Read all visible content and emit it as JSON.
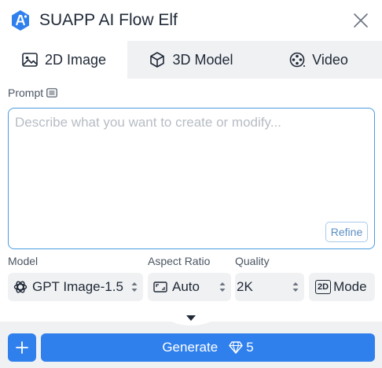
{
  "window": {
    "title": "SUAPP AI Flow Elf",
    "logo_icon": "suapp-logo",
    "close_icon": "close-icon"
  },
  "tabs": [
    {
      "label": "2D Image",
      "icon": "image-icon",
      "active": true
    },
    {
      "label": "3D Model",
      "icon": "cube-icon",
      "active": false
    },
    {
      "label": "Video",
      "icon": "film-reel-icon",
      "active": false
    }
  ],
  "prompt": {
    "label": "Prompt",
    "label_icon": "list-icon",
    "placeholder": "Describe what you want to create or modify...",
    "value": "",
    "refine_label": "Refine"
  },
  "settings": {
    "model": {
      "label": "Model",
      "value": "GPT Image-1.5",
      "icon": "openai-icon"
    },
    "aspect_ratio": {
      "label": "Aspect Ratio",
      "value": "Auto",
      "icon": "aspect-ratio-icon"
    },
    "quality": {
      "label": "Quality",
      "value": "2K"
    },
    "mode": {
      "value": "Mode",
      "icon": "2d-badge-icon",
      "icon_text": "2D"
    }
  },
  "footer": {
    "add_icon": "plus-icon",
    "generate_label": "Generate",
    "cost_icon": "diamond-icon",
    "cost": "5"
  },
  "colors": {
    "accent": "#2f80ed",
    "focus_border": "#4a9be0",
    "panel_bg": "#f0f1f3"
  }
}
